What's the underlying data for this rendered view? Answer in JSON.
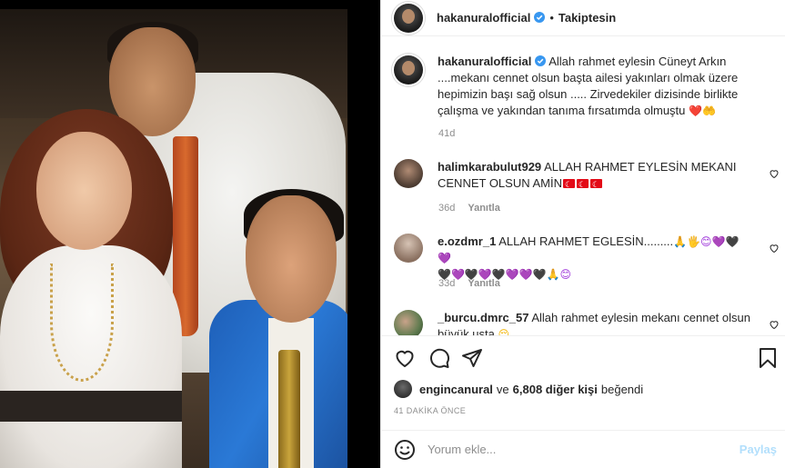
{
  "header": {
    "username": "hakanuralofficial",
    "dot": "•",
    "follow_status": "Takiptesin"
  },
  "caption": {
    "username": "hakanuralofficial",
    "text": "Allah rahmet eylesin Cüneyt Arkın ....mekanı cennet olsun başta ailesi yakınları olmak üzere hepimizin başı sağ olsun ..... Zirvedekiler dizisinde birlikte çalışma ve yakından tanıma fırsatımda olmuştu",
    "emoji": "❤️🤲",
    "time": "41d"
  },
  "comments": [
    {
      "username": "halimkarabulut929",
      "text": "ALLAH RAHMET EYLESİN MEKANI CENNET OLSUN AMİN",
      "emoji": "🇹🇷🇹🇷🇹🇷",
      "time": "36d",
      "reply": "Yanıtla"
    },
    {
      "username": "e.ozdmr_1",
      "text": "ALLAH RAHMET EGLESİN.........",
      "emoji_line1": "🙏🖐😊💜🖤💜",
      "emoji_line2": "🖤💜🖤💜🖤💜💜🖤🙏😊",
      "time": "33d",
      "reply": "Yanıtla"
    },
    {
      "username": "_burcu.dmrc_57",
      "text": "Allah rahmet eylesin mekanı cennet olsun büyük usta",
      "emoji": "😔"
    }
  ],
  "likes": {
    "user": "engincanural",
    "connector": "ve",
    "count": "6,808 diğer kişi",
    "suffix": "beğendi"
  },
  "timestamp": "41 DAKİKA ÖNCE",
  "add_comment": {
    "placeholder": "Yorum ekle...",
    "share_label": "Paylaş"
  },
  "colors": {
    "verified_blue": "#3897f0",
    "share_disabled": "#b2dffc",
    "muted_text": "#8e8e8e"
  }
}
